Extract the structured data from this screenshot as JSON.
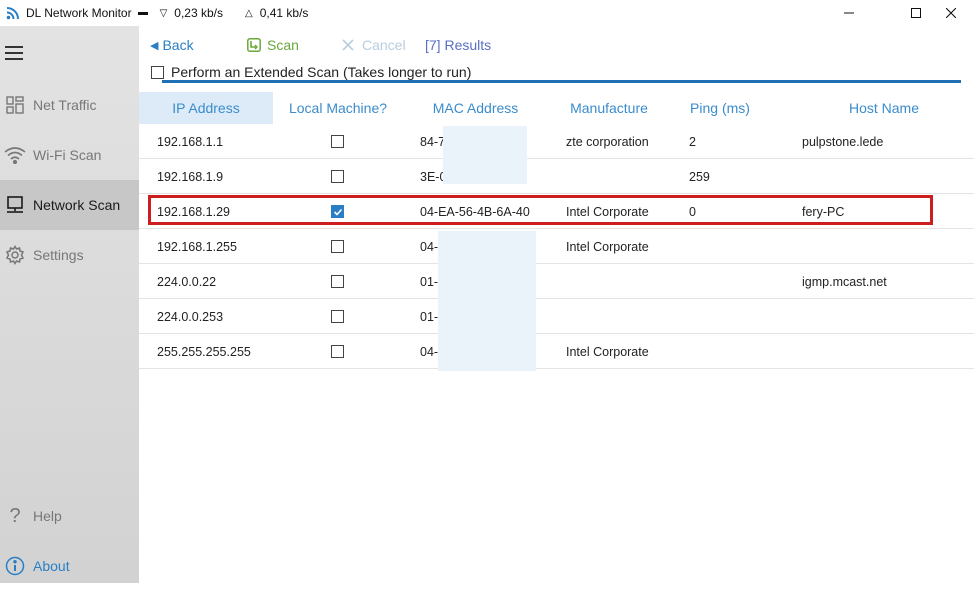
{
  "titlebar": {
    "app_title": "DL Network Monitor",
    "download_rate": "0,23 kb/s",
    "upload_rate": "0,41 kb/s",
    "icons": {
      "app": "wifi-signal-icon",
      "down": "download-arrow-icon",
      "up": "upload-arrow-icon"
    }
  },
  "sidebar": {
    "menu_icon": "hamburger-icon",
    "items": [
      {
        "label": "Net Traffic",
        "icon": "grid-icon",
        "active": false
      },
      {
        "label": "Wi-Fi Scan",
        "icon": "wifi-icon",
        "active": false
      },
      {
        "label": "Network Scan",
        "icon": "monitor-icon",
        "active": true
      },
      {
        "label": "Settings",
        "icon": "gear-icon",
        "active": false
      }
    ],
    "help_label": "Help",
    "about_label": "About"
  },
  "toolbar": {
    "back_label": "Back",
    "scan_label": "Scan",
    "cancel_label": "Cancel",
    "results_label": "[7] Results"
  },
  "extended_scan": {
    "label": "Perform an Extended Scan (Takes longer to run)",
    "checked": false
  },
  "table": {
    "headers": [
      "IP Address",
      "Local Machine?",
      "MAC Address",
      "Manufacture",
      "Ping (ms)",
      "Host Name"
    ],
    "rows": [
      {
        "ip": "192.168.1.1",
        "local": false,
        "mac": "84-7",
        "manufacture": "zte corporation",
        "ping": "2",
        "host": "pulpstone.lede"
      },
      {
        "ip": "192.168.1.9",
        "local": false,
        "mac": "3E-0",
        "manufacture": "",
        "ping": "259",
        "host": ""
      },
      {
        "ip": "192.168.1.29",
        "local": true,
        "mac": "04-EA-56-4B-6A-40",
        "manufacture": "Intel Corporate",
        "ping": "0",
        "host": "fery-PC"
      },
      {
        "ip": "192.168.1.255",
        "local": false,
        "mac": "04-",
        "manufacture": "Intel Corporate",
        "ping": "",
        "host": ""
      },
      {
        "ip": "224.0.0.22",
        "local": false,
        "mac": "01-",
        "manufacture": "",
        "ping": "",
        "host": "igmp.mcast.net"
      },
      {
        "ip": "224.0.0.253",
        "local": false,
        "mac": "01-",
        "manufacture": "",
        "ping": "",
        "host": ""
      },
      {
        "ip": "255.255.255.255",
        "local": false,
        "mac": "04-",
        "manufacture": "Intel Corporate",
        "ping": "",
        "host": ""
      }
    ]
  },
  "colors": {
    "accent": "#2a7fc4",
    "scan_green": "#6aa83a",
    "highlight_red": "#cc1e1e",
    "progress_blue": "#1e6fb4"
  }
}
